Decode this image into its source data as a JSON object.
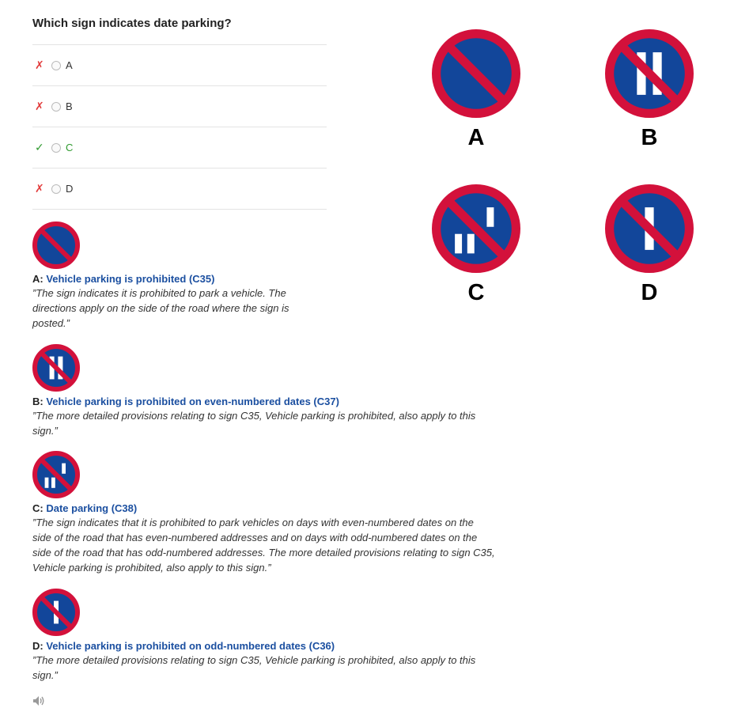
{
  "question": "Which sign indicates date parking?",
  "options": [
    {
      "letter": "A",
      "status": "wrong",
      "mark": "✗"
    },
    {
      "letter": "B",
      "status": "wrong",
      "mark": "✗"
    },
    {
      "letter": "C",
      "status": "correct",
      "mark": "✓"
    },
    {
      "letter": "D",
      "status": "wrong",
      "mark": "✗"
    }
  ],
  "colors": {
    "sign_red": "#d3113b",
    "sign_blue": "#12469a",
    "title_blue": "#1b4fa0",
    "correct_green": "#2f9a2f",
    "wrong_red": "#e23b3b"
  },
  "explanations": [
    {
      "letter": "A:",
      "title": "Vehicle parking is prohibited (C35)",
      "lines": [
        "”The sign indicates it is prohibited to park a vehicle. The",
        "directions apply on the side of the road where the sign is",
        "posted.”"
      ]
    },
    {
      "letter": "B:",
      "title": "Vehicle parking is prohibited on even-numbered dates (C37)",
      "lines": [
        "”The more detailed provisions relating to sign C35, Vehicle parking is prohibited, also apply to this",
        "sign.”"
      ]
    },
    {
      "letter": "C:",
      "title": "Date parking (C38)",
      "lines": [
        "”The sign indicates that it is prohibited to park vehicles on days with even-numbered dates on the",
        "side of the road that has even-numbered addresses and on days with odd-numbered dates on the",
        "side of the road that has odd-numbered addresses. The more detailed provisions relating to sign C35,",
        "Vehicle parking is prohibited, also apply to this sign.”"
      ]
    },
    {
      "letter": "D:",
      "title": "Vehicle parking is prohibited on odd-numbered dates (C36)",
      "lines": [
        "”The more detailed provisions relating to sign C35, Vehicle parking is prohibited, also apply to this",
        "sign.”"
      ]
    }
  ],
  "grid_labels": [
    "A",
    "B",
    "C",
    "D"
  ],
  "audio_icon": "speaker-icon"
}
